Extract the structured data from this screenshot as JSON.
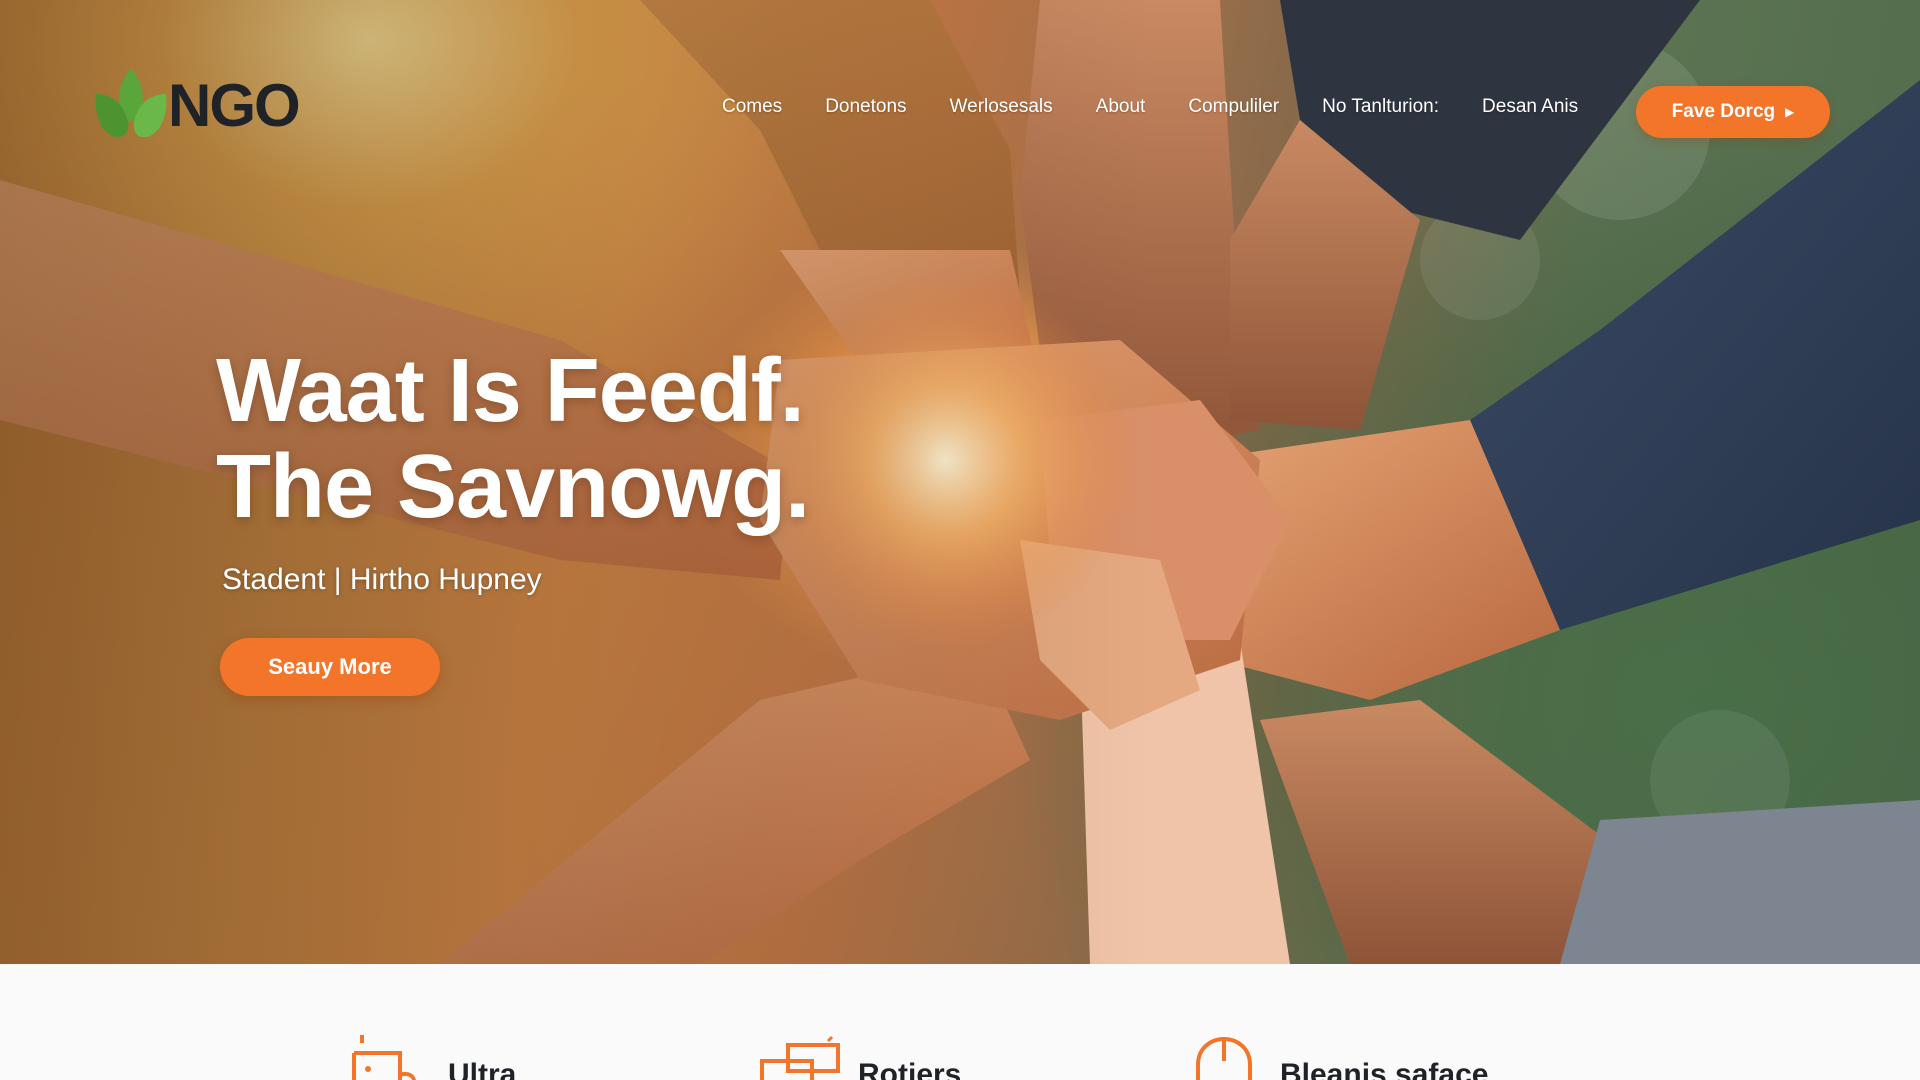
{
  "brand": {
    "logo_text": "NGO",
    "leaf_color": "#5aa63a",
    "accent_color": "#f2752a",
    "logo_icon": "leaf-icon"
  },
  "nav": {
    "items": [
      {
        "label": "Comes"
      },
      {
        "label": "Donetons"
      },
      {
        "label": "Werlosesals"
      },
      {
        "label": "About"
      },
      {
        "label": "Compuliler"
      },
      {
        "label": "No Tanlturion:"
      },
      {
        "label": "Desan Anis"
      }
    ],
    "cta_label": "Fave Dorcg",
    "cta_icon": "play-arrow-icon"
  },
  "hero": {
    "title_line1": "Waat Is Feedf.",
    "title_line2": "The Savnowg.",
    "subtitle": "Stadent | Hirtho Hupney",
    "button_label": "Seauy More"
  },
  "features": {
    "items": [
      {
        "label": "Ultra",
        "icon": "box-cart-icon"
      },
      {
        "label": "Rotiers",
        "icon": "stacked-boxes-icon"
      },
      {
        "label": "Bleanis saface",
        "icon": "hands-icon"
      }
    ]
  }
}
